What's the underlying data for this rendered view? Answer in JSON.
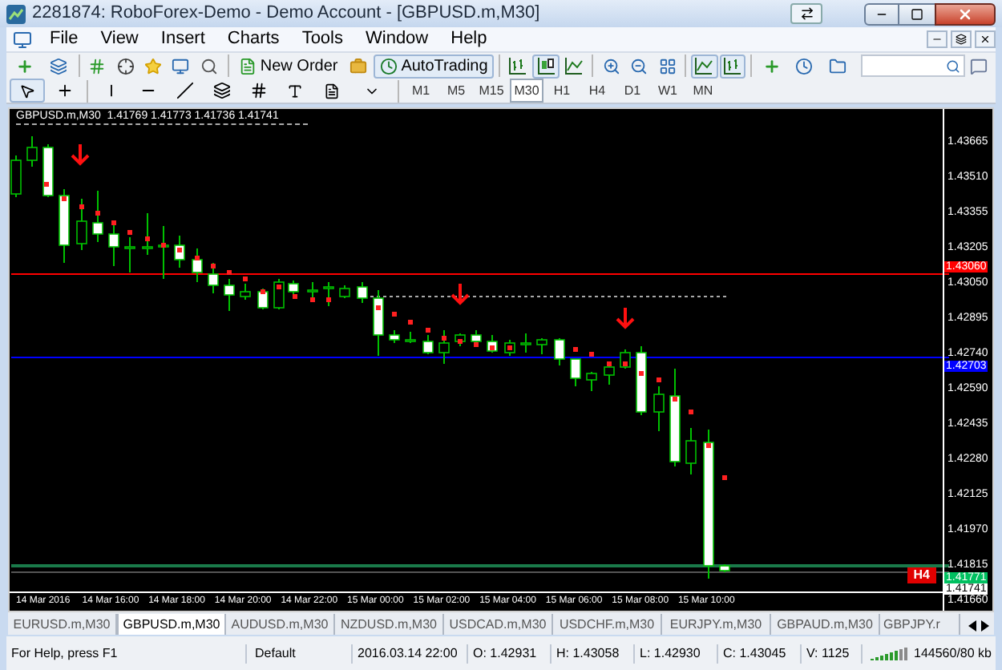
{
  "window": {
    "title": "2281874: RoboForex-Demo - Demo Account - [GBPUSD.m,M30]"
  },
  "menu": [
    "File",
    "View",
    "Insert",
    "Charts",
    "Tools",
    "Window",
    "Help"
  ],
  "toolbar": {
    "new_order": "New Order",
    "auto_trading": "AutoTrading"
  },
  "timeframes": [
    {
      "label": "M1",
      "selected": false
    },
    {
      "label": "M5",
      "selected": false
    },
    {
      "label": "M15",
      "selected": false
    },
    {
      "label": "M30",
      "selected": true
    },
    {
      "label": "H1",
      "selected": false
    },
    {
      "label": "H4",
      "selected": false
    },
    {
      "label": "D1",
      "selected": false
    },
    {
      "label": "W1",
      "selected": false
    },
    {
      "label": "MN",
      "selected": false
    }
  ],
  "chart": {
    "header": "GBPUSD.m,M30  1.41769 1.41773 1.41736 1.41741",
    "price_ticks": [
      "1.43665",
      "1.43510",
      "1.43355",
      "1.43205",
      "1.43050",
      "1.42895",
      "1.42740",
      "1.42590",
      "1.42435",
      "1.42280",
      "1.42125",
      "1.41970",
      "1.41815",
      "1.41660"
    ],
    "price_markers": [
      {
        "label": "1.43060",
        "color": "#ff0000"
      },
      {
        "label": "1.42703",
        "color": "#0000ff"
      },
      {
        "label": "1.41771",
        "color": "#00c060"
      },
      {
        "label": "1.41741",
        "color": "#ffffff"
      }
    ],
    "time_labels": [
      "14 Mar 2016",
      "14 Mar 16:00",
      "14 Mar 18:00",
      "14 Mar 20:00",
      "14 Mar 22:00",
      "15 Mar 00:00",
      "15 Mar 02:00",
      "15 Mar 04:00",
      "15 Mar 06:00",
      "15 Mar 08:00",
      "15 Mar 10:00"
    ],
    "badge": "H4"
  },
  "tabs": [
    {
      "label": "EURUSD.m,M30",
      "selected": false
    },
    {
      "label": "GBPUSD.m,M30",
      "selected": true
    },
    {
      "label": "AUDUSD.m,M30",
      "selected": false
    },
    {
      "label": "NZDUSD.m,M30",
      "selected": false
    },
    {
      "label": "USDCAD.m,M30",
      "selected": false
    },
    {
      "label": "USDCHF.m,M30",
      "selected": false
    },
    {
      "label": "EURJPY.m,M30",
      "selected": false
    },
    {
      "label": "GBPAUD.m,M30",
      "selected": false
    },
    {
      "label": "GBPJPY.r",
      "selected": false
    }
  ],
  "status_bar": {
    "help": "For Help, press F1",
    "profile": "Default",
    "time": "2016.03.14 22:00",
    "open": "O: 1.42931",
    "high": "H: 1.43058",
    "low": "L: 1.42930",
    "close": "C: 1.43045",
    "volume": "V: 1125",
    "traffic": "144560/80 kb"
  }
}
